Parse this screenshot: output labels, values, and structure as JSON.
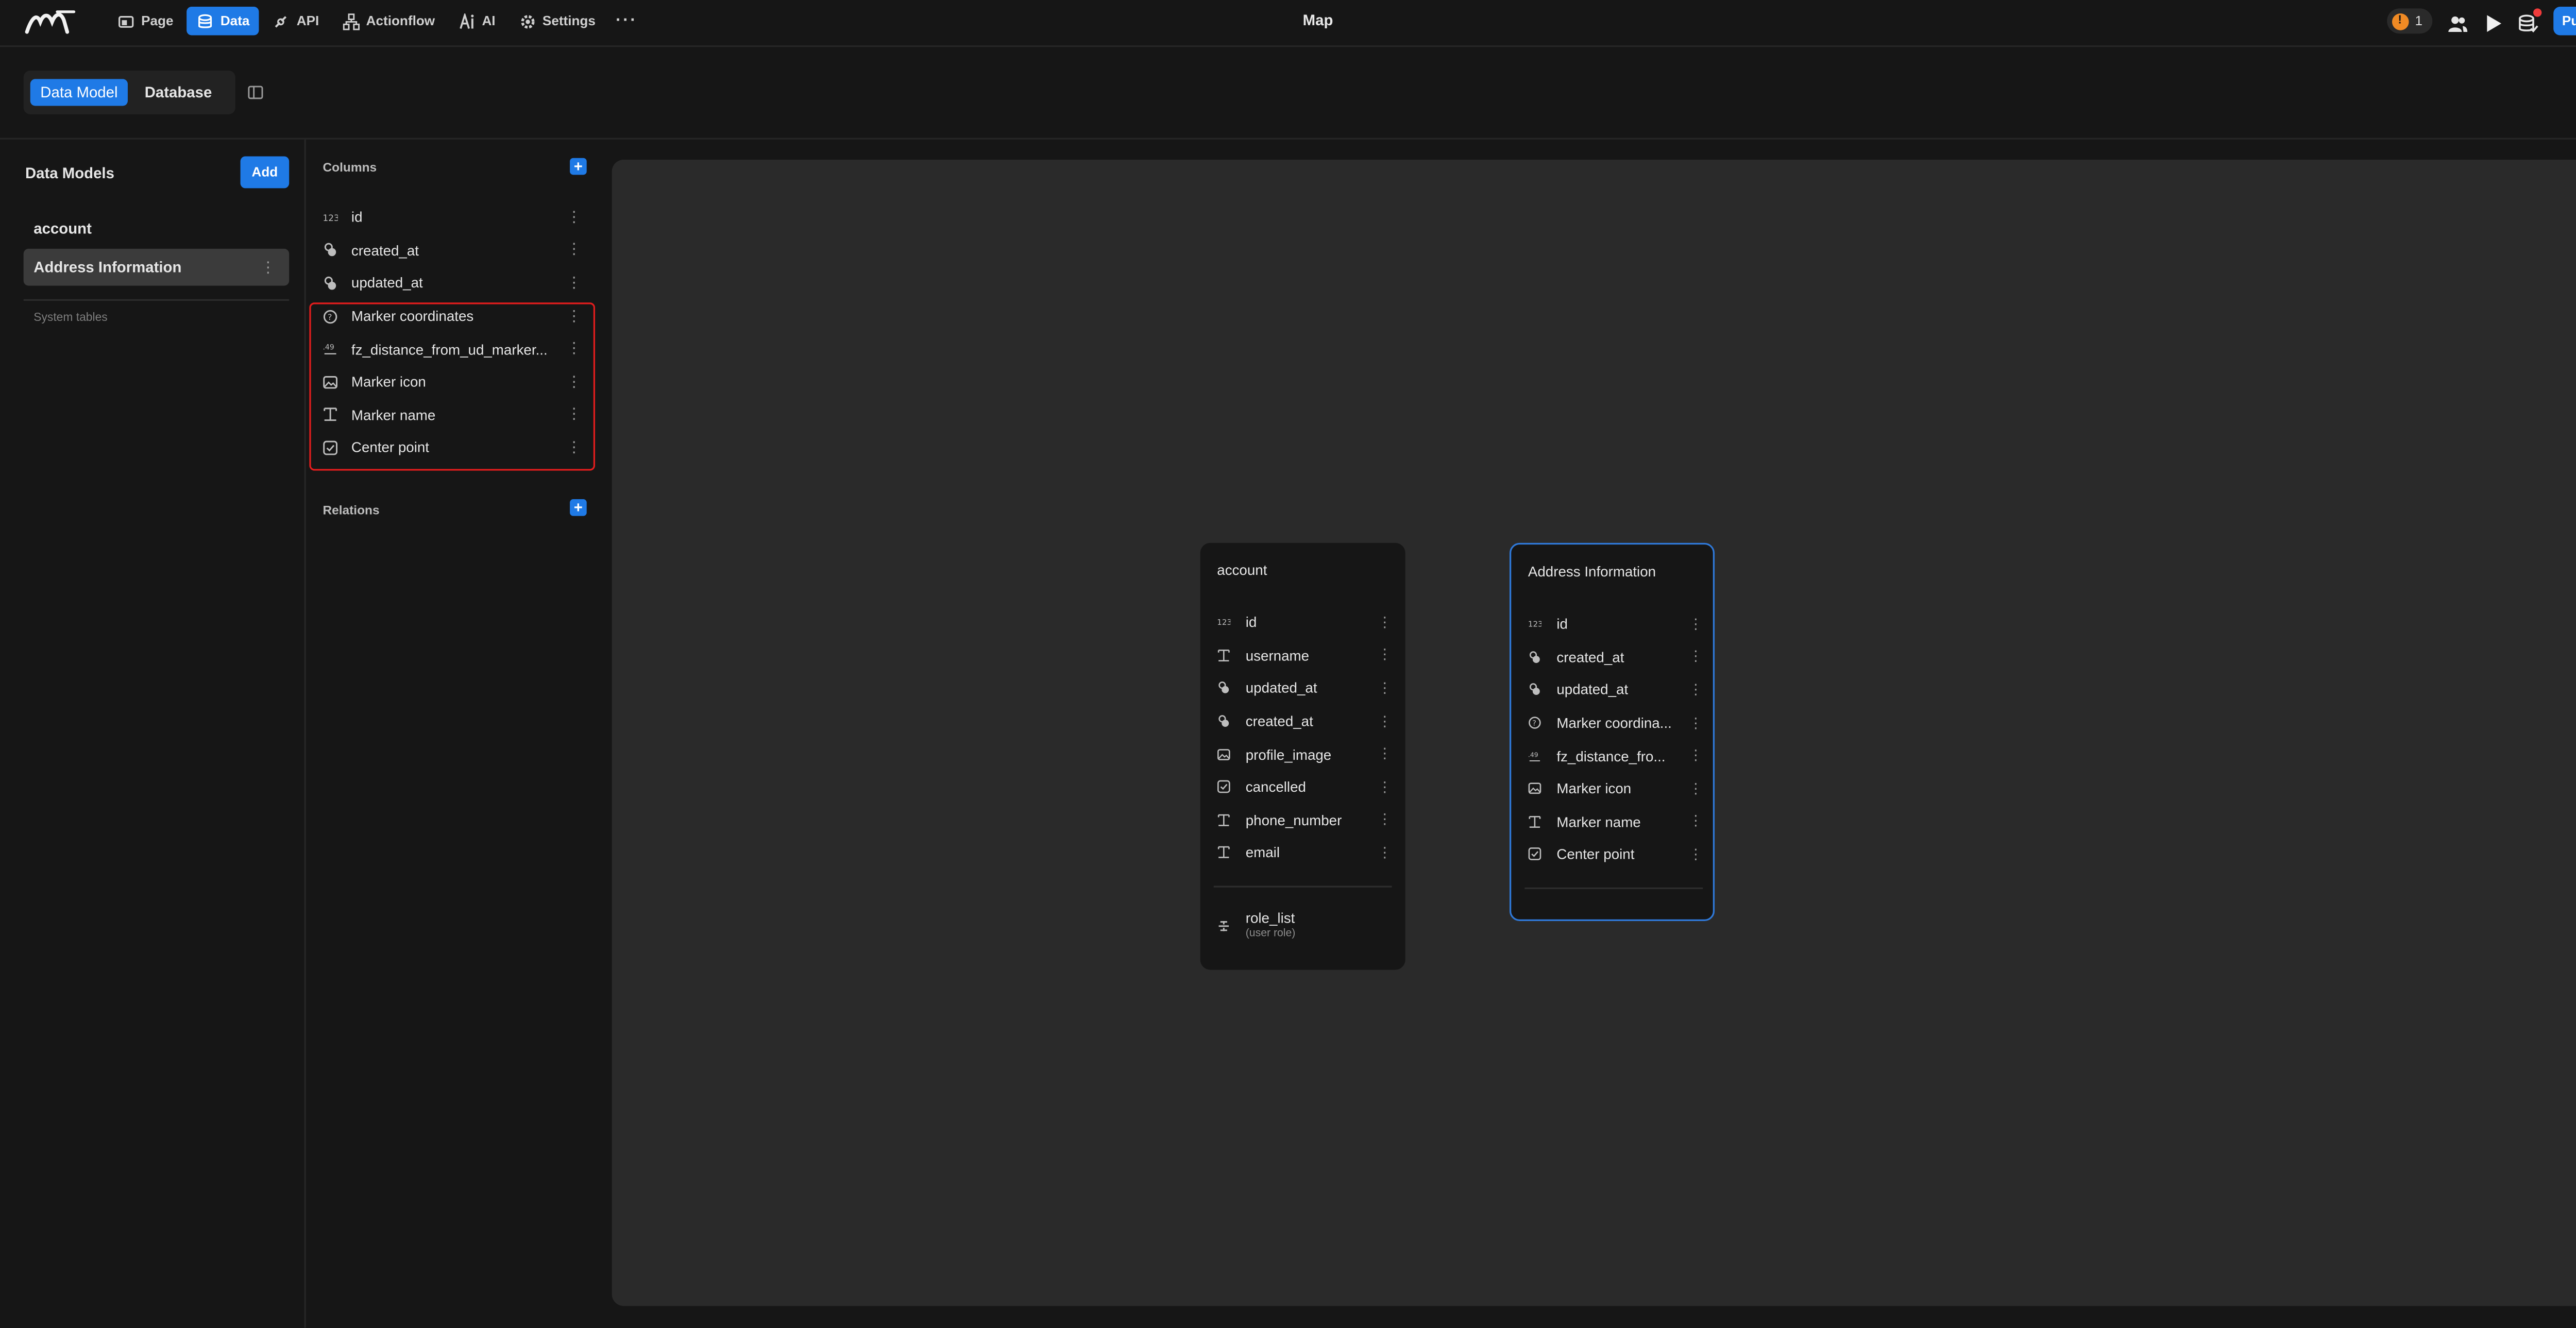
{
  "topbar": {
    "title": "Map",
    "nav": [
      {
        "label": "Page",
        "icon": "page-icon",
        "active": false
      },
      {
        "label": "Data",
        "icon": "database-icon",
        "active": true
      },
      {
        "label": "API",
        "icon": "api-icon",
        "active": false
      },
      {
        "label": "Actionflow",
        "icon": "actionflow-icon",
        "active": false
      },
      {
        "label": "AI",
        "icon": "ai-icon",
        "active": false
      },
      {
        "label": "Settings",
        "icon": "gear-icon",
        "active": false
      }
    ],
    "warning_count": "1",
    "publish_label": "Publish"
  },
  "subbar": {
    "data_model_tab": "Data Model",
    "database_tab": "Database"
  },
  "sidebar": {
    "title": "Data Models",
    "add_label": "Add",
    "models": [
      {
        "name": "account",
        "selected": false
      },
      {
        "name": "Address Information",
        "selected": true
      }
    ],
    "system_tables_label": "System tables"
  },
  "columns_panel": {
    "columns_title": "Columns",
    "relations_title": "Relations",
    "columns": [
      {
        "name": "id",
        "icon": "number-icon"
      },
      {
        "name": "created_at",
        "icon": "timestamp-icon"
      },
      {
        "name": "updated_at",
        "icon": "timestamp-icon"
      },
      {
        "name": "Marker coordinates",
        "icon": "geo-point-icon"
      },
      {
        "name": "fz_distance_from_ud_marker...",
        "icon": "decimal-icon"
      },
      {
        "name": "Marker icon",
        "icon": "image-icon"
      },
      {
        "name": "Marker name",
        "icon": "text-icon"
      },
      {
        "name": "Center point",
        "icon": "checkbox-icon"
      }
    ]
  },
  "canvas": {
    "account_card": {
      "title": "account",
      "columns": [
        {
          "name": "id",
          "icon": "number-icon"
        },
        {
          "name": "username",
          "icon": "text-icon"
        },
        {
          "name": "updated_at",
          "icon": "timestamp-icon"
        },
        {
          "name": "created_at",
          "icon": "timestamp-icon"
        },
        {
          "name": "profile_image",
          "icon": "image-icon"
        },
        {
          "name": "cancelled",
          "icon": "checkbox-icon"
        },
        {
          "name": "phone_number",
          "icon": "text-icon"
        },
        {
          "name": "email",
          "icon": "text-icon"
        }
      ],
      "relation": {
        "name": "role_list",
        "sub": "(user role)",
        "icon": "relation-icon"
      }
    },
    "address_card": {
      "title": "Address Information",
      "columns": [
        {
          "name": "id",
          "icon": "number-icon"
        },
        {
          "name": "created_at",
          "icon": "timestamp-icon"
        },
        {
          "name": "updated_at",
          "icon": "timestamp-icon"
        },
        {
          "name": "Marker coordina...",
          "icon": "geo-point-icon"
        },
        {
          "name": "fz_distance_fro...",
          "icon": "decimal-icon"
        },
        {
          "name": "Marker icon",
          "icon": "image-icon"
        },
        {
          "name": "Marker name",
          "icon": "text-icon"
        },
        {
          "name": "Center point",
          "icon": "checkbox-icon"
        }
      ]
    }
  },
  "colors": {
    "accent": "#1f7ae6",
    "highlight": "#e11d1d",
    "warning": "#f08a24"
  }
}
